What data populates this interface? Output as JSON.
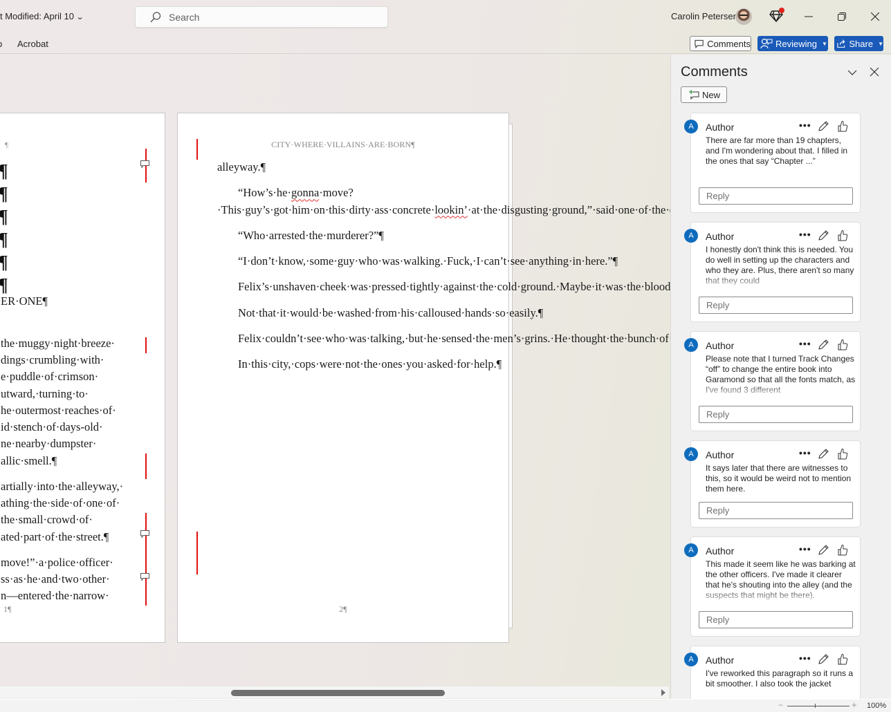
{
  "titlebar": {
    "doc_title": "t Modified: April 10",
    "search_placeholder": "Search",
    "user_name": "Carolin Petersen"
  },
  "ribbon": {
    "partial_tab": "p",
    "tab_acrobat": "Acrobat",
    "comments_label": "Comments",
    "reviewing_label": "Reviewing",
    "share_label": "Share"
  },
  "page1": {
    "small_para": "¶",
    "empty_paras": [
      "¶",
      "¶",
      "¶",
      "¶",
      "¶",
      "¶"
    ],
    "chapter": "ER·ONE¶",
    "lines": [
      "the·muggy·night·breeze·",
      "dings·crumbling·with·",
      "e·puddle·of·crimson·",
      "utward,·turning·to·",
      "he·outermost·reaches·of·",
      "id·stench·of·days-old·",
      "ne·nearby·dumpster·",
      "allic·smell.¶",
      "artially·into·the·alleyway,·",
      "athing·the·side·of·one·of·",
      "the·small·crowd·of·",
      "ated·part·of·the·street.¶",
      "move!”·a·police·officer·",
      "ss·as·he·and·two·other·",
      "n—entered·the·narrow·"
    ],
    "page_number": "1¶"
  },
  "page2": {
    "header": "CITY·WHERE·VILLAINS·ARE·BORN¶",
    "p0": "alleyway.¶",
    "p1_a": "“How’s·he·",
    "p1_sq1": "gonna",
    "p1_b": "·move?·This·guy’s·got·him·on·this·dirty·ass·concrete·",
    "p1_sq2": "lookin’",
    "p1_c": "·at·the·disgusting·ground,”·said·one·of·the·officers·to·his·coworkers.¶",
    "p2": "“Who·arrested·the·murderer?”¶",
    "p3": "“I·don’t·know,·some·guy·who·was·walking.·Fuck,·I·can’t·see·anything·in·here.”¶",
    "p4": "Felix’s·unshaven·cheek·was·pressed·tightly·against·the·cold·ground.·Maybe·it·was·the·blood·that·made·the·ground·so·wet.·It·hadn’t·rained·yet·even·though·the·sky·was·filled·with·clouds·just·waiting·to·dump·their·load·and·wash·away·the·blood.¶",
    "p5": "Not·that·it·would·be·washed·from·his·calloused·hands·so·easily.¶",
    "p6": "Felix·couldn’t·see·who·was·talking,·but·he·sensed·the·men’s·grins.·He·thought·the·bunch·of·them,·the·cops,·probably·looked·like·jackals·circling·their·prey·as·they·surrounded·him.¶",
    "p7": "In·this·city,·cops·were·not·the·ones·you·asked·for·help.¶",
    "page_number": "2¶"
  },
  "statusbar": {
    "zoom_minus": "−",
    "zoom_plus": "+",
    "zoom_level": "100%"
  },
  "comments_pane": {
    "title": "Comments",
    "new_label": "New",
    "reply_placeholder": "Reply",
    "cards": [
      {
        "initial": "A",
        "author": "Author",
        "text": "There are far more than 19 chapters, and I'm wondering about that. I filled in the ones that say “Chapter ...”"
      },
      {
        "initial": "A",
        "author": "Author",
        "text": "I honestly don't think this is needed. You do well in setting up the characters and who they are. Plus, there aren't so many that they could"
      },
      {
        "initial": "A",
        "author": "Author",
        "text": "Please note that I turned Track Changes “off” to change the entire book into Garamond so that all the fonts match, as I've found 3 different"
      },
      {
        "initial": "A",
        "author": "Author",
        "text": "It says later that there are witnesses to this, so it would be weird not to mention them here."
      },
      {
        "initial": "A",
        "author": "Author",
        "text": "This made it seem like he was barking at the other officers. I've made it clearer that he's shouting into the alley (and the suspects that might be there)."
      },
      {
        "initial": "A",
        "author": "Author",
        "text": "I've reworked this paragraph so it runs a bit smoother. I also took the jacket"
      }
    ]
  },
  "colors": {
    "accent": "#1a5ab8",
    "avatar": "#0f6cbd",
    "revision_bar": "#e01010",
    "notification": "#e0241b"
  }
}
